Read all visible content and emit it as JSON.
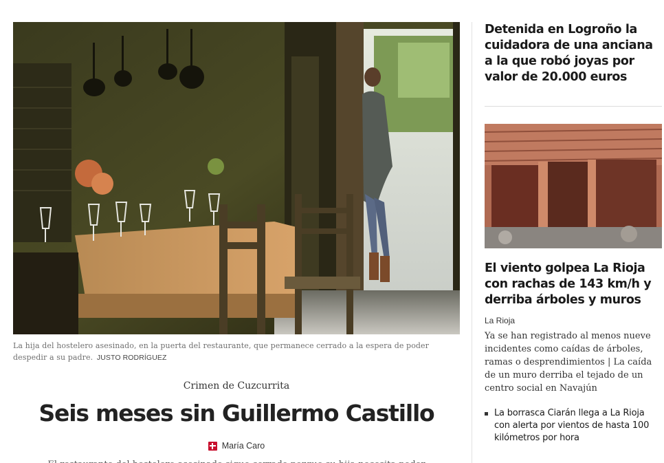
{
  "main": {
    "caption": "La hija del hostelero asesinado, en la puerta del restaurante, que permanece cerrado a la espera de poder despedir a su padre.",
    "credit": "JUSTO RODRÍGUEZ",
    "kicker": "Crimen de Cuzcurrita",
    "headline": "Seis meses sin Guillermo Castillo",
    "author": "María Caro",
    "lead": "El restaurante del hostelero asesinado sigue cerrado porque su hija necesita poder"
  },
  "sidebar": {
    "story1_title": "Detenida en Logroño la cuidadora de una anciana a la que robó joyas por valor de 20.000 euros",
    "story2_title": "El viento golpea La Rioja con rachas de 143 km/h y derriba árboles y muros",
    "story2_section": "La Rioja",
    "story2_summary": "Ya se han registrado al menos nueve incidentes como caídas de árboles, ramas o desprendimientos | La caída de un muro derriba el tejado de un centro social en Navajún",
    "related": "La borrasca Ciarán llega a La Rioja con alerta por vientos de hasta 100 kilómetros por hora"
  },
  "colors": {
    "brand_red": "#c8102e",
    "divider": "#e1e1e1"
  }
}
